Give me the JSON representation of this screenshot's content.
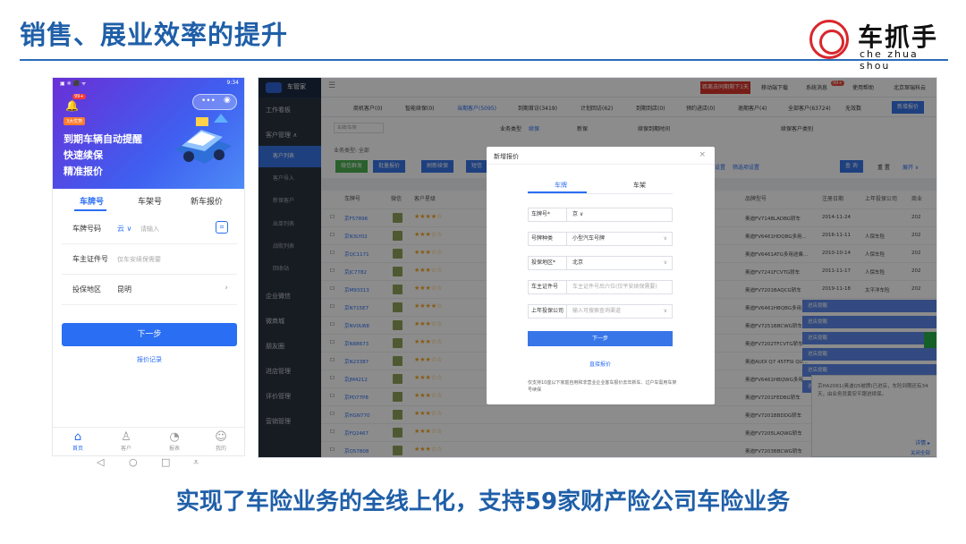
{
  "slide": {
    "title": "销售、展业效率的提升",
    "footer": "实现了车险业务的全线上化，支持59家财产险公司车险业务"
  },
  "logo": {
    "name": "车抓手",
    "sub": "che zhua shou"
  },
  "phone": {
    "status_time": "9:34",
    "status_left": "▣ ❈ ⬛ ᯤ",
    "badge": "99+",
    "banner_tag": "3大优势",
    "banner_lines": [
      "到期车辆自动提醒",
      "快速续保",
      "精准报价"
    ],
    "tabs": [
      "车牌号",
      "车架号",
      "新车报价"
    ],
    "rows": [
      {
        "label": "车牌号码",
        "value": "云 ∨",
        "placeholder": "请输入"
      },
      {
        "label": "车主证件号",
        "value": "",
        "placeholder": "仅车安续保需要"
      },
      {
        "label": "投保地区",
        "value": "昆明",
        "placeholder": ""
      }
    ],
    "next_button": "下一步",
    "quote_link": "报价记录",
    "nav": [
      "首页",
      "客户",
      "报表",
      "我的"
    ]
  },
  "desktop": {
    "app_name": "车管家",
    "top_red": "距离去同期剩下1天",
    "top_items": [
      "移动端下载",
      "系统消息",
      "使用帮助",
      "北京琛瑞科云"
    ],
    "msg_badge": "99+",
    "sidebar": [
      {
        "label": "工作看板",
        "sub": false
      },
      {
        "label": "客户管理 ∧",
        "sub": false
      },
      {
        "label": "客户列表",
        "sub": true,
        "active": true
      },
      {
        "label": "客户导入",
        "sub": true
      },
      {
        "label": "新保客户",
        "sub": true
      },
      {
        "label": "出单列表",
        "sub": true
      },
      {
        "label": "战败列表",
        "sub": true
      },
      {
        "label": "回收站",
        "sub": true
      },
      {
        "label": "企业微信",
        "sub": false
      },
      {
        "label": "微商城",
        "sub": false
      },
      {
        "label": "朋友圈",
        "sub": false
      },
      {
        "label": "进店管理",
        "sub": false
      },
      {
        "label": "评价管理",
        "sub": false
      },
      {
        "label": "营销管理",
        "sub": false
      }
    ],
    "tabs": [
      "商机客户(0)",
      "智能续保(0)",
      "当期客户(5095)",
      "到期首访(3419)",
      "计划回访(62)",
      "到期到店(0)",
      "预约进店(0)",
      "逾期客户(4)",
      "全部客户(63724)",
      "无效数"
    ],
    "tab_button": "新增报价",
    "filters": {
      "plate": "车牌/车架",
      "biz_type_label": "业务类型",
      "biz_opt1": "续保",
      "biz_opt2": "新保",
      "expire_label": "续保到期时间",
      "cust_type_label": "续保客户类别",
      "biz_type_2": "业务类型: 全部",
      "search": "查 询",
      "reset": "重 置",
      "expand": "展开 ∨",
      "settings": "设置",
      "filter_settings": "筛选项设置"
    },
    "toolbar": [
      "微信群发",
      "批量报价",
      "刷新续保",
      "短信"
    ],
    "columns": [
      "车牌号",
      "微信",
      "客户星级",
      "品牌型号",
      "注册日期",
      "上年投保公司",
      "商业"
    ],
    "rows": [
      {
        "plate": "京F57896",
        "stars": "★★★★☆",
        "brand": "奥迪FV7148LADBG轿车",
        "date": "2014-11-24",
        "ins": "",
        "y": "202"
      },
      {
        "plate": "京N3LY02",
        "stars": "★★★☆☆",
        "brand": "奥迪FV6461HDQBG多用...",
        "date": "2016-11-11",
        "ins": "人保车险",
        "y": "202"
      },
      {
        "plate": "京QC1171",
        "stars": "★★★☆☆",
        "brand": "奥迪FV6461ATG多用途乘...",
        "date": "2010-10-14",
        "ins": "人保车险",
        "y": "202"
      },
      {
        "plate": "京JC7782",
        "stars": "★★★☆☆",
        "brand": "奥迪FV7241FCVTG轿车",
        "date": "2011-11-17",
        "ins": "人保车险",
        "y": "202"
      },
      {
        "plate": "京M93313",
        "stars": "★★★☆☆",
        "brand": "奥迪FV7201BAQCG轿车",
        "date": "2019-11-18",
        "ins": "太平洋车险",
        "y": "202"
      },
      {
        "plate": "京N715E7",
        "stars": "★★★★☆",
        "brand": "奥迪FV6461HBQBG多用...",
        "date": "",
        "ins": "",
        "y": ""
      },
      {
        "plate": "京NV0U68",
        "stars": "★★★☆☆",
        "brand": "奥迪FV7251BBCWG轿车",
        "date": "",
        "ins": "",
        "y": ""
      },
      {
        "plate": "京N88673",
        "stars": "★★★☆☆",
        "brand": "奥迪FV7202TFCVTG轿车",
        "date": "",
        "ins": "",
        "y": ""
      },
      {
        "plate": "京N23387",
        "stars": "★★★☆☆",
        "brand": "奥迪AUDI Q7 45TFSI QU...",
        "date": "",
        "ins": "",
        "y": ""
      },
      {
        "plate": "京JM4212",
        "stars": "★★★☆☆",
        "brand": "奥迪FV6461HBQWG多用...",
        "date": "",
        "ins": "",
        "y": ""
      },
      {
        "plate": "京PD77P8",
        "stars": "★★★☆☆",
        "brand": "奥迪FV7201FEDBG轿车",
        "date": "",
        "ins": "",
        "y": ""
      },
      {
        "plate": "京HGN770",
        "stars": "★★★☆☆",
        "brand": "奥迪FV7201BBDDG轿车",
        "date": "",
        "ins": "",
        "y": ""
      },
      {
        "plate": "京FQ2467",
        "stars": "★★★☆☆",
        "brand": "奥迪FV7205LAQWG轿车",
        "date": "",
        "ins": "",
        "y": ""
      },
      {
        "plate": "京Q57808",
        "stars": "★★★☆☆",
        "brand": "奥迪FV7203BBCWG轿车",
        "date": "",
        "ins": "",
        "y": ""
      }
    ],
    "notices": [
      "进店提醒",
      "进店提醒",
      "进店提醒",
      "进店提醒",
      "进店提醒",
      "进店提醒"
    ],
    "popup_text": "京HA2061(奥迪Q5被牌)已进店，车险到期还有34天，由业务员黄安平跟进续保。",
    "popup_detail": "详情 ▸",
    "popup_close": "关闭全部"
  },
  "modal": {
    "title": "新增报价",
    "tabs": [
      "车牌",
      "车架"
    ],
    "fields": [
      {
        "label": "车牌号*",
        "value": "京  ∨",
        "ph": false
      },
      {
        "label": "号牌种类",
        "value": "小型汽车号牌",
        "ph": false
      },
      {
        "label": "投保地区*",
        "value": "北京",
        "ph": false
      },
      {
        "label": "车主证件号",
        "value": "车主证件号后六位(仅平安续保需要)",
        "ph": true
      },
      {
        "label": "上年投保公司",
        "value": "输入可搜索查询渠道",
        "ph": true
      }
    ],
    "next_button": "下一步",
    "direct_link": "直接报价",
    "note": "仅支持10座以下家庭自用和非营业企业客车报价去年新车、过户车需用车架号续保"
  }
}
